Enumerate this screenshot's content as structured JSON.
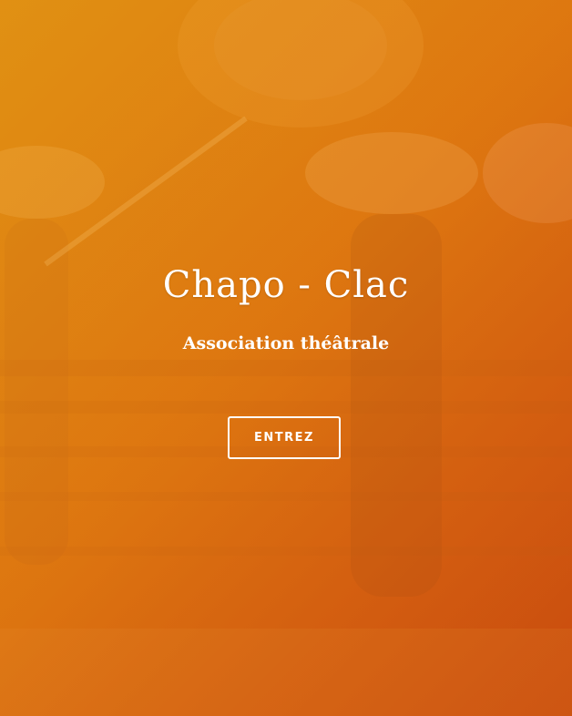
{
  "hero": {
    "title": "Chapo - Clac",
    "subtitle": "Association théâtrale",
    "enter_label": "ENTREZ"
  },
  "colors": {
    "overlay_start": "#e8961a",
    "overlay_end": "#cd4e0f",
    "text": "#ffffff"
  }
}
